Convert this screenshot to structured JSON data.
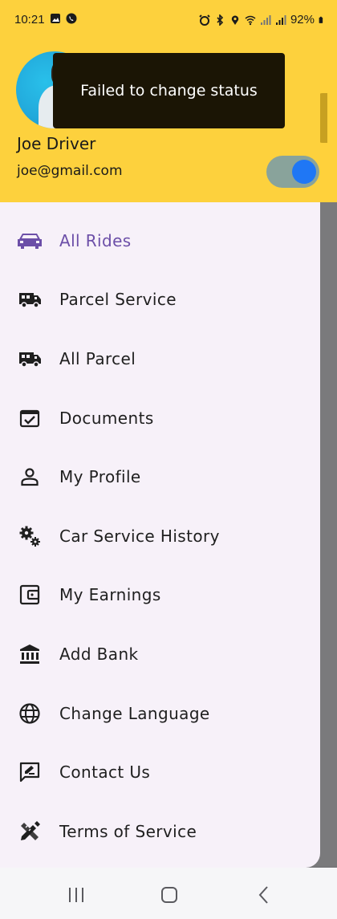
{
  "status": {
    "time": "10:21",
    "battery": "92%",
    "left_icons": [
      "image-icon",
      "call-icon"
    ],
    "right_icons": [
      "alarm-icon",
      "bluetooth-icon",
      "location-icon",
      "wifi-icon",
      "signal-icon",
      "signal-icon",
      "battery-icon"
    ]
  },
  "header": {
    "name": "Joe Driver",
    "email": "joe@gmail.com",
    "online_toggle_on": true
  },
  "toast": {
    "message": "Failed to change status"
  },
  "menu": {
    "items": [
      {
        "label": "All Rides",
        "icon": "car-icon",
        "active": true
      },
      {
        "label": "Parcel Service",
        "icon": "van-icon"
      },
      {
        "label": "All Parcel",
        "icon": "van-icon"
      },
      {
        "label": "Documents",
        "icon": "calendar-check-icon"
      },
      {
        "label": "My Profile",
        "icon": "person-icon"
      },
      {
        "label": "Car Service History",
        "icon": "gears-icon"
      },
      {
        "label": "My Earnings",
        "icon": "wallet-icon"
      },
      {
        "label": "Add Bank",
        "icon": "bank-icon"
      },
      {
        "label": "Change Language",
        "icon": "globe-icon"
      },
      {
        "label": "Contact Us",
        "icon": "chat-edit-icon"
      },
      {
        "label": "Terms of Service",
        "icon": "design-tools-icon"
      }
    ]
  },
  "colors": {
    "header": "#fdd13d",
    "active": "#6c4fa8",
    "drawer": "#f7f1f9",
    "toggle_knob": "#1f77f5"
  },
  "navbar": {
    "buttons": [
      "recent-apps-icon",
      "home-icon",
      "back-icon"
    ]
  }
}
